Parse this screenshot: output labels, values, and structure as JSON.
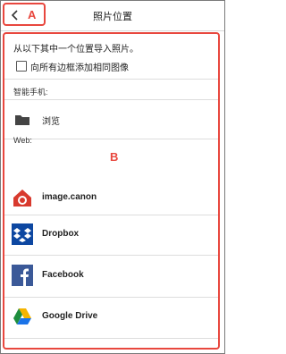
{
  "header": {
    "title": "照片位置",
    "back_icon": "chevron-left-icon"
  },
  "callouts": {
    "a": "A",
    "b": "B"
  },
  "intro_text": "从以下其中一个位置导入照片。",
  "border_option": {
    "label": "向所有边框添加相同图像",
    "checked": false
  },
  "smartphone_section": {
    "label": "智能手机:",
    "items": [
      {
        "label": "浏览",
        "icon": "folder-icon"
      }
    ]
  },
  "web_section": {
    "label": "Web:",
    "items": [
      {
        "label": "image.canon",
        "icon": "image-canon-icon"
      },
      {
        "label": "Dropbox",
        "icon": "dropbox-icon"
      },
      {
        "label": "Facebook",
        "icon": "facebook-icon"
      },
      {
        "label": "Google Drive",
        "icon": "google-drive-icon"
      }
    ]
  },
  "colors": {
    "callout": "#e8473e",
    "divider": "#dddddd",
    "dropbox": "#0d47a1",
    "facebook": "#3b5998",
    "canon": "#d83a2e"
  }
}
